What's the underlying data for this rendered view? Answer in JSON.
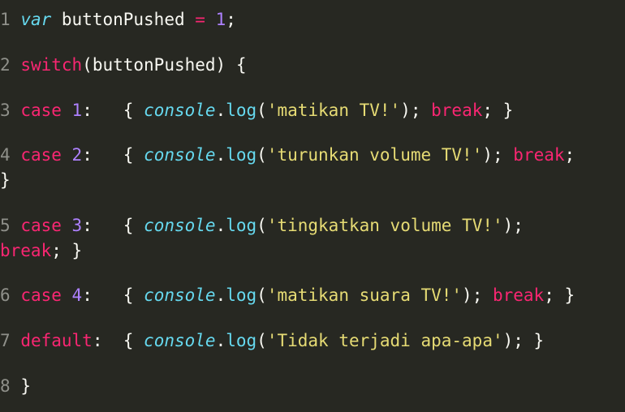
{
  "editor": {
    "colors": {
      "background": "#272822",
      "plain": "#f8f8f2",
      "line_number": "#8f908a",
      "keyword": "#f92672",
      "storage": "#66d9ef",
      "number": "#ae81ff",
      "function": "#66d9ef",
      "string": "#e6db74"
    },
    "lines": [
      {
        "n": "1",
        "tokens": [
          {
            "t": "var",
            "c": "st"
          },
          {
            "t": " buttonPushed ",
            "c": "pl"
          },
          {
            "t": "=",
            "c": "kw"
          },
          {
            "t": " ",
            "c": "pl"
          },
          {
            "t": "1",
            "c": "num"
          },
          {
            "t": ";",
            "c": "pl"
          }
        ]
      },
      {
        "n": "2",
        "tokens": [
          {
            "t": "switch",
            "c": "kw"
          },
          {
            "t": "(buttonPushed) {",
            "c": "pl"
          }
        ]
      },
      {
        "n": "3",
        "tokens": [
          {
            "t": "case",
            "c": "kw"
          },
          {
            "t": " ",
            "c": "pl"
          },
          {
            "t": "1",
            "c": "num"
          },
          {
            "t": ":   { ",
            "c": "pl"
          },
          {
            "t": "console",
            "c": "st"
          },
          {
            "t": ".",
            "c": "pl"
          },
          {
            "t": "log",
            "c": "fn"
          },
          {
            "t": "(",
            "c": "pl"
          },
          {
            "t": "'matikan TV!'",
            "c": "str"
          },
          {
            "t": "); ",
            "c": "pl"
          },
          {
            "t": "break",
            "c": "kw"
          },
          {
            "t": "; }",
            "c": "pl"
          }
        ]
      },
      {
        "n": "4",
        "tokens": [
          {
            "t": "case",
            "c": "kw"
          },
          {
            "t": " ",
            "c": "pl"
          },
          {
            "t": "2",
            "c": "num"
          },
          {
            "t": ":   { ",
            "c": "pl"
          },
          {
            "t": "console",
            "c": "st"
          },
          {
            "t": ".",
            "c": "pl"
          },
          {
            "t": "log",
            "c": "fn"
          },
          {
            "t": "(",
            "c": "pl"
          },
          {
            "t": "'turunkan volume TV!'",
            "c": "str"
          },
          {
            "t": "); ",
            "c": "pl"
          },
          {
            "t": "break",
            "c": "kw"
          },
          {
            "t": ";",
            "c": "pl"
          }
        ],
        "wrap": [
          {
            "t": "}",
            "c": "pl"
          }
        ]
      },
      {
        "n": "5",
        "tokens": [
          {
            "t": "case",
            "c": "kw"
          },
          {
            "t": " ",
            "c": "pl"
          },
          {
            "t": "3",
            "c": "num"
          },
          {
            "t": ":   { ",
            "c": "pl"
          },
          {
            "t": "console",
            "c": "st"
          },
          {
            "t": ".",
            "c": "pl"
          },
          {
            "t": "log",
            "c": "fn"
          },
          {
            "t": "(",
            "c": "pl"
          },
          {
            "t": "'tingkatkan volume TV!'",
            "c": "str"
          },
          {
            "t": ");",
            "c": "pl"
          }
        ],
        "wrap": [
          {
            "t": "break",
            "c": "kw"
          },
          {
            "t": "; }",
            "c": "pl"
          }
        ]
      },
      {
        "n": "6",
        "tokens": [
          {
            "t": "case",
            "c": "kw"
          },
          {
            "t": " ",
            "c": "pl"
          },
          {
            "t": "4",
            "c": "num"
          },
          {
            "t": ":   { ",
            "c": "pl"
          },
          {
            "t": "console",
            "c": "st"
          },
          {
            "t": ".",
            "c": "pl"
          },
          {
            "t": "log",
            "c": "fn"
          },
          {
            "t": "(",
            "c": "pl"
          },
          {
            "t": "'matikan suara TV!'",
            "c": "str"
          },
          {
            "t": "); ",
            "c": "pl"
          },
          {
            "t": "break",
            "c": "kw"
          },
          {
            "t": "; }",
            "c": "pl"
          }
        ]
      },
      {
        "n": "7",
        "tokens": [
          {
            "t": "default",
            "c": "kw"
          },
          {
            "t": ":  { ",
            "c": "pl"
          },
          {
            "t": "console",
            "c": "st"
          },
          {
            "t": ".",
            "c": "pl"
          },
          {
            "t": "log",
            "c": "fn"
          },
          {
            "t": "(",
            "c": "pl"
          },
          {
            "t": "'Tidak terjadi apa-apa'",
            "c": "str"
          },
          {
            "t": "); }",
            "c": "pl"
          }
        ]
      },
      {
        "n": "8",
        "tokens": [
          {
            "t": "}",
            "c": "pl"
          }
        ]
      }
    ]
  }
}
